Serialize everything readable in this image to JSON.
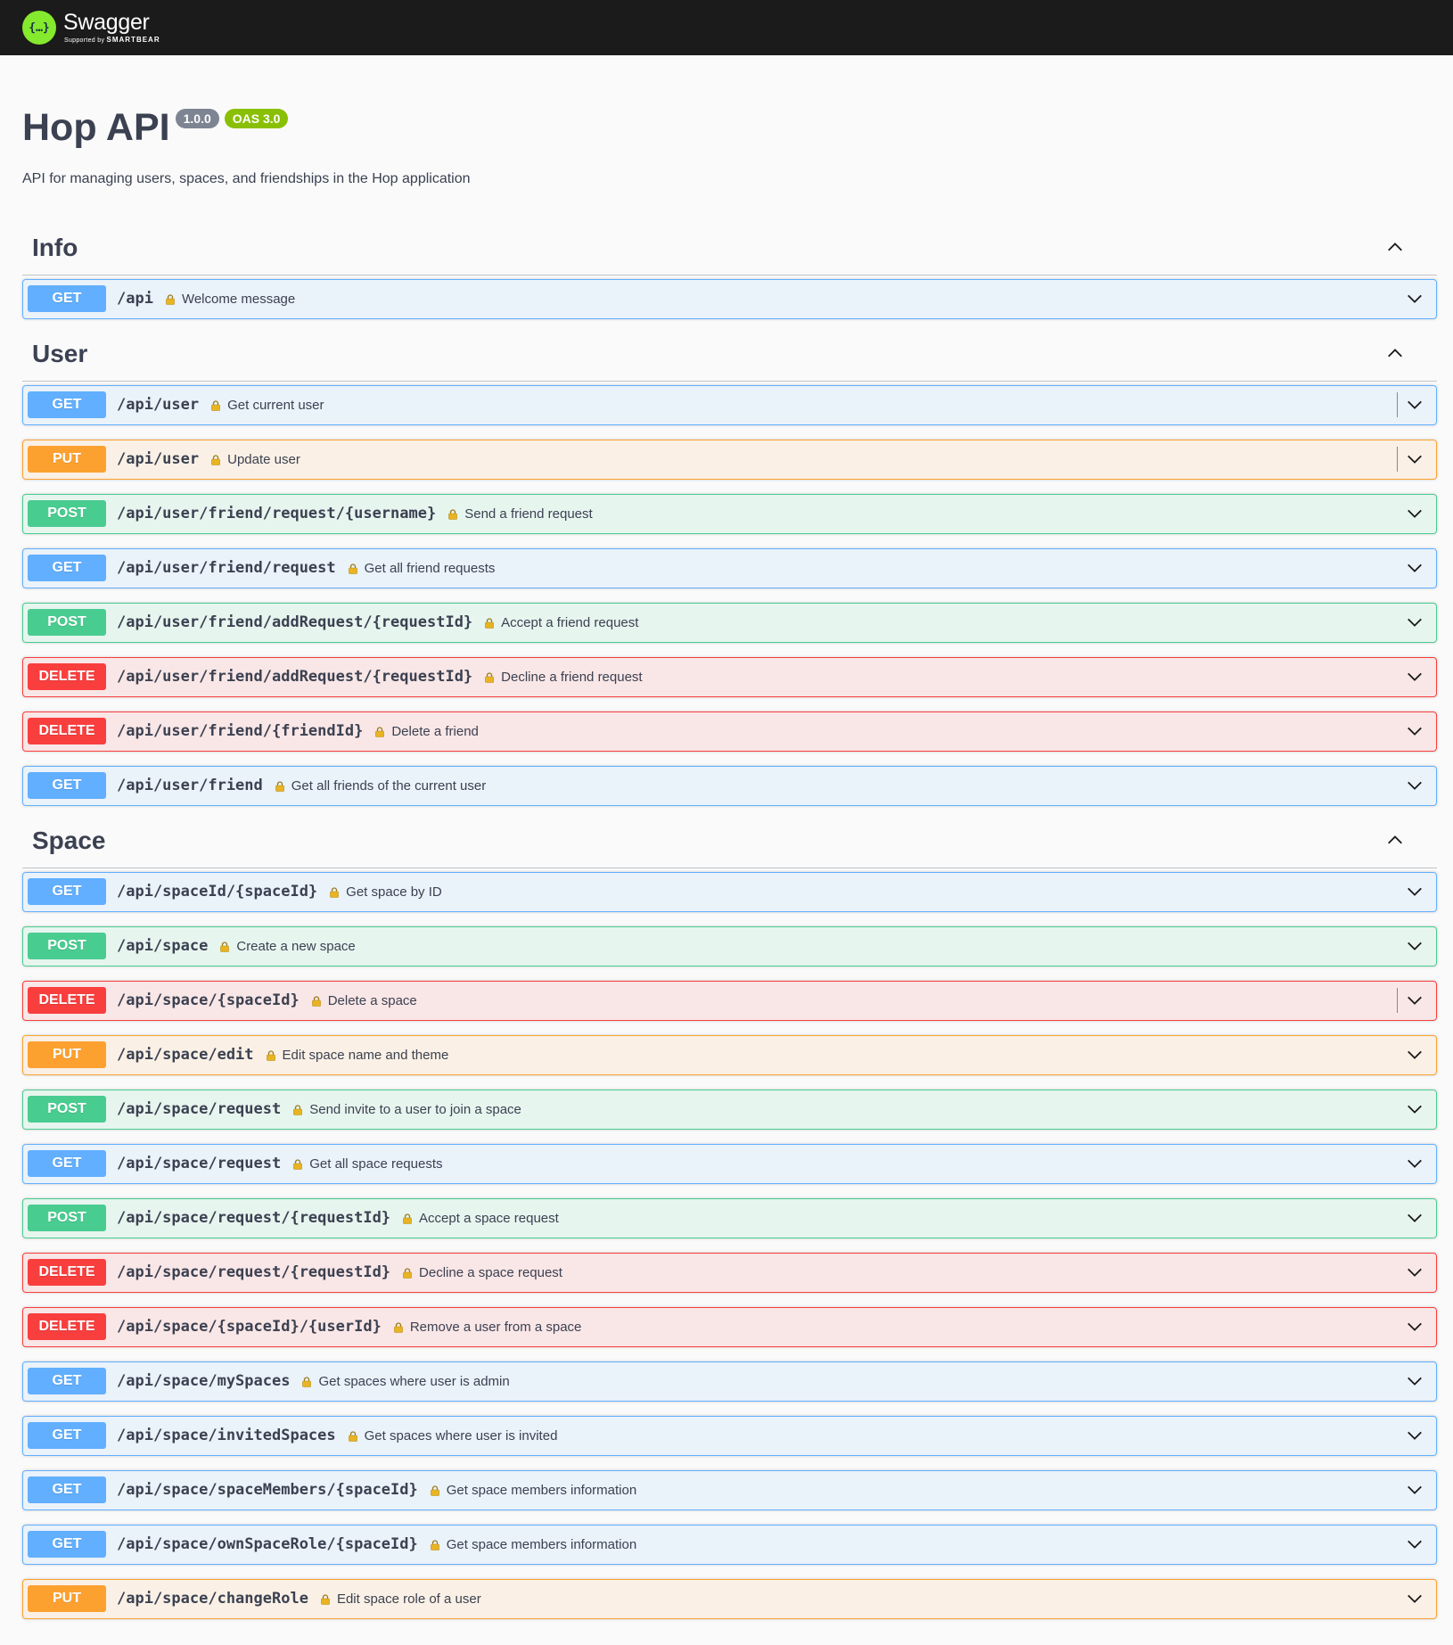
{
  "topbar": {
    "brand": "Swagger",
    "supported_by": "Supported by",
    "company": "SMARTBEAR"
  },
  "info": {
    "title": "Hop API",
    "version": "1.0.0",
    "oas": "OAS 3.0",
    "description": "API for managing users, spaces, and friendships in the Hop application"
  },
  "colors": {
    "get": "#61affe",
    "post": "#49cc90",
    "put": "#fca130",
    "delete": "#f93e3e",
    "topbar": "#1b1b1b"
  },
  "tags": [
    {
      "name": "Info",
      "operations": [
        {
          "method": "GET",
          "path": "/api",
          "summary": "Welcome message"
        }
      ]
    },
    {
      "name": "User",
      "operations": [
        {
          "method": "GET",
          "path": "/api/user",
          "summary": "Get current user"
        },
        {
          "method": "PUT",
          "path": "/api/user",
          "summary": "Update user"
        },
        {
          "method": "POST",
          "path": "/api/user/friend/request/{username}",
          "summary": "Send a friend request"
        },
        {
          "method": "GET",
          "path": "/api/user/friend/request",
          "summary": "Get all friend requests"
        },
        {
          "method": "POST",
          "path": "/api/user/friend/addRequest/{requestId}",
          "summary": "Accept a friend request"
        },
        {
          "method": "DELETE",
          "path": "/api/user/friend/addRequest/{requestId}",
          "summary": "Decline a friend request"
        },
        {
          "method": "DELETE",
          "path": "/api/user/friend/{friendId}",
          "summary": "Delete a friend"
        },
        {
          "method": "GET",
          "path": "/api/user/friend",
          "summary": "Get all friends of the current user"
        }
      ]
    },
    {
      "name": "Space",
      "operations": [
        {
          "method": "GET",
          "path": "/api/spaceId/{spaceId}",
          "summary": "Get space by ID"
        },
        {
          "method": "POST",
          "path": "/api/space",
          "summary": "Create a new space"
        },
        {
          "method": "DELETE",
          "path": "/api/space/{spaceId}",
          "summary": "Delete a space"
        },
        {
          "method": "PUT",
          "path": "/api/space/edit",
          "summary": "Edit space name and theme"
        },
        {
          "method": "POST",
          "path": "/api/space/request",
          "summary": "Send invite to a user to join a space"
        },
        {
          "method": "GET",
          "path": "/api/space/request",
          "summary": "Get all space requests"
        },
        {
          "method": "POST",
          "path": "/api/space/request/{requestId}",
          "summary": "Accept a space request"
        },
        {
          "method": "DELETE",
          "path": "/api/space/request/{requestId}",
          "summary": "Decline a space request"
        },
        {
          "method": "DELETE",
          "path": "/api/space/{spaceId}/{userId}",
          "summary": "Remove a user from a space"
        },
        {
          "method": "GET",
          "path": "/api/space/mySpaces",
          "summary": "Get spaces where user is admin"
        },
        {
          "method": "GET",
          "path": "/api/space/invitedSpaces",
          "summary": "Get spaces where user is invited"
        },
        {
          "method": "GET",
          "path": "/api/space/spaceMembers/{spaceId}",
          "summary": "Get space members information"
        },
        {
          "method": "GET",
          "path": "/api/space/ownSpaceRole/{spaceId}",
          "summary": "Get space members information"
        },
        {
          "method": "PUT",
          "path": "/api/space/changeRole",
          "summary": "Edit space role of a user"
        }
      ]
    }
  ]
}
